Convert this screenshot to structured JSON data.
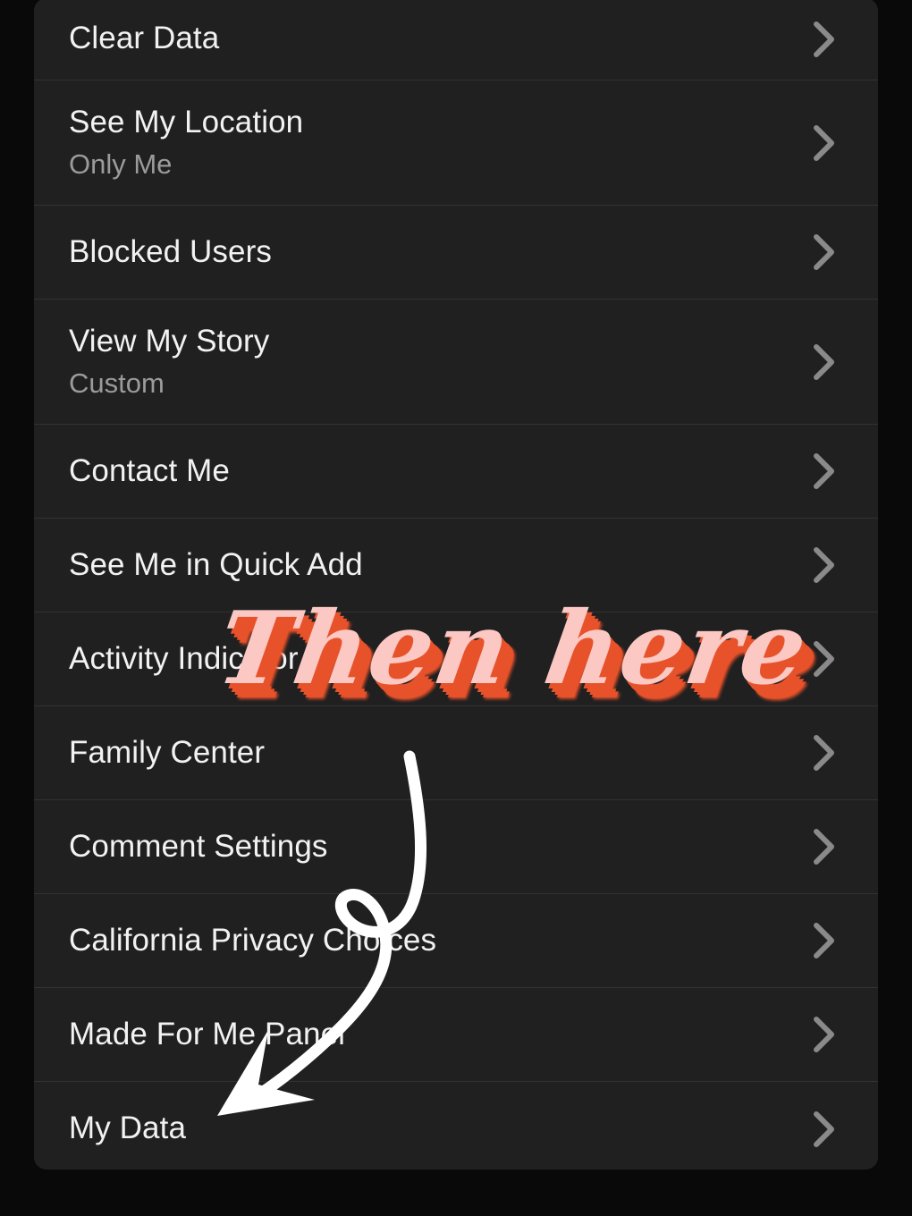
{
  "screen": {
    "background_color": "#09090a",
    "panel_background_color": "#202021",
    "divider_color": "#323233",
    "label_color": "#f2f2f2",
    "sublabel_color": "#9b9b9b",
    "chevron_color": "#8a8a8a"
  },
  "settings_list": {
    "rows": [
      {
        "label": "Clear Data",
        "value": "",
        "chevron": "chevron-right-icon"
      },
      {
        "label": "See My Location",
        "value": "Only Me",
        "chevron": "chevron-right-icon"
      },
      {
        "label": "Blocked Users",
        "value": "",
        "chevron": "chevron-right-icon"
      },
      {
        "label": "View My Story",
        "value": "Custom",
        "chevron": "chevron-right-icon"
      },
      {
        "label": "Contact Me",
        "value": "",
        "chevron": "chevron-right-icon"
      },
      {
        "label": "See Me in Quick Add",
        "value": "",
        "chevron": "chevron-right-icon"
      },
      {
        "label": "Activity Indicator",
        "value": "",
        "chevron": "chevron-right-icon"
      },
      {
        "label": "Family Center",
        "value": "",
        "chevron": "chevron-right-icon"
      },
      {
        "label": "Comment Settings",
        "value": "",
        "chevron": "chevron-right-icon"
      },
      {
        "label": "California Privacy Choices",
        "value": "",
        "chevron": "chevron-right-icon"
      },
      {
        "label": "Made For Me Panel",
        "value": "",
        "chevron": "chevron-right-icon"
      },
      {
        "label": "My Data",
        "value": "",
        "chevron": "chevron-right-icon"
      }
    ]
  },
  "annotation": {
    "text": "Then here",
    "text_color": "#fbc8c3",
    "shadow_color": "#e8522a",
    "arrow_color": "#ffffff",
    "arrow_description": "curved-looping-arrow-pointing-down-left-to-my-data"
  }
}
